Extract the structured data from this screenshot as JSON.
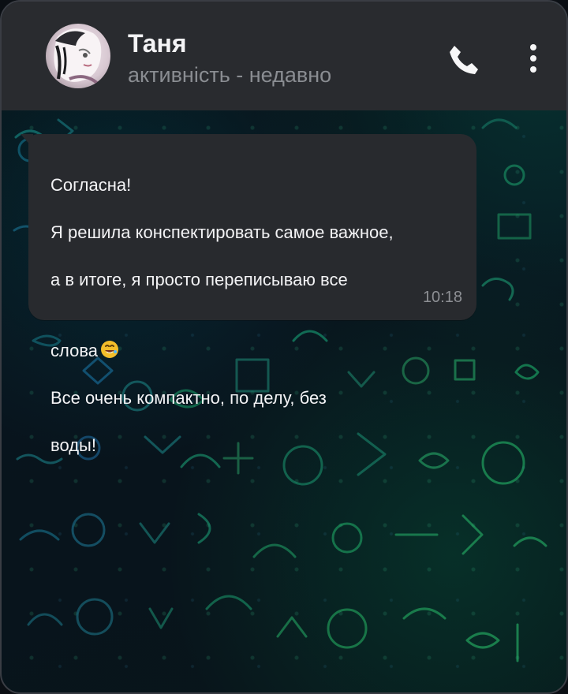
{
  "header": {
    "name": "Таня",
    "status": "активність - недавно",
    "icons": {
      "avatar": "profile-avatar",
      "call": "phone-icon",
      "menu": "more-vertical-icon"
    }
  },
  "message": {
    "line1": "Согласна!",
    "line2": "Я решила конспектировать самое важное,",
    "line3": "а в итоге, я просто переписываю все",
    "line4": "слова",
    "emoji": "🤣",
    "line5": "Все очень компактно, по делу, без",
    "line6": "воды!",
    "time": "10:18"
  },
  "colors": {
    "header_bg": "#292b2f",
    "bubble_bg": "#282a2e",
    "text_primary": "#f3f3f5",
    "text_secondary": "#8a8d92",
    "doodle_green": "#24b46d"
  }
}
